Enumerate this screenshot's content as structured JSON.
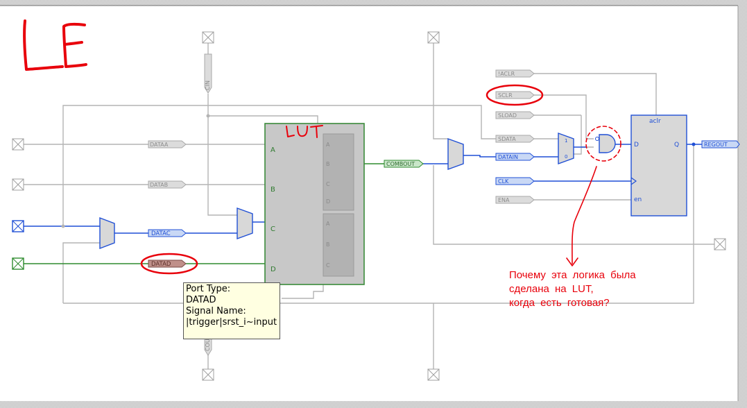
{
  "annotations": {
    "title": "LE",
    "lut_label": "LUT",
    "question": [
      "Почему эта логика была",
      "сделана на LUT,",
      "когда есть готовая?"
    ]
  },
  "ports": {
    "dataa": "DATAA",
    "datab": "DATAB",
    "datac": "DATAC",
    "datad": "DATAD",
    "combout": "COMBOUT",
    "aclr": "!ACLR",
    "sclr": "SCLR",
    "sload": "SLOAD",
    "sdata": "SDATA",
    "datain": "DATAIN",
    "clk": "CLK",
    "ena": "ENA",
    "regout": "REGOUT",
    "cin": "CIN",
    "cout": "COUT"
  },
  "lut_pins": {
    "a": "A",
    "b": "B",
    "c": "C",
    "d": "D"
  },
  "lut_sub_pins": [
    "A",
    "B",
    "C",
    "D",
    "A",
    "B",
    "C"
  ],
  "mux_pins": {
    "one": "1",
    "zero": "0"
  },
  "register": {
    "aclr": "aclr",
    "d": "D",
    "q": "Q",
    "en": "en"
  },
  "tooltip": {
    "line1": "Port Type:",
    "line2": "DATAD",
    "line3": "Signal Name:",
    "line4": "|trigger|srst_i~input"
  },
  "colors": {
    "active_wire": "#1f4fd6",
    "datad_wire": "#2e8b2e",
    "inactive_wire": "#b4b4b4",
    "annotation": "#e8000b",
    "lut_fill": "#c8c8c8",
    "lut_border": "#3a8a3a",
    "register_fill": "#d8d8d8",
    "tooltip_bg": "#ffffe1"
  }
}
